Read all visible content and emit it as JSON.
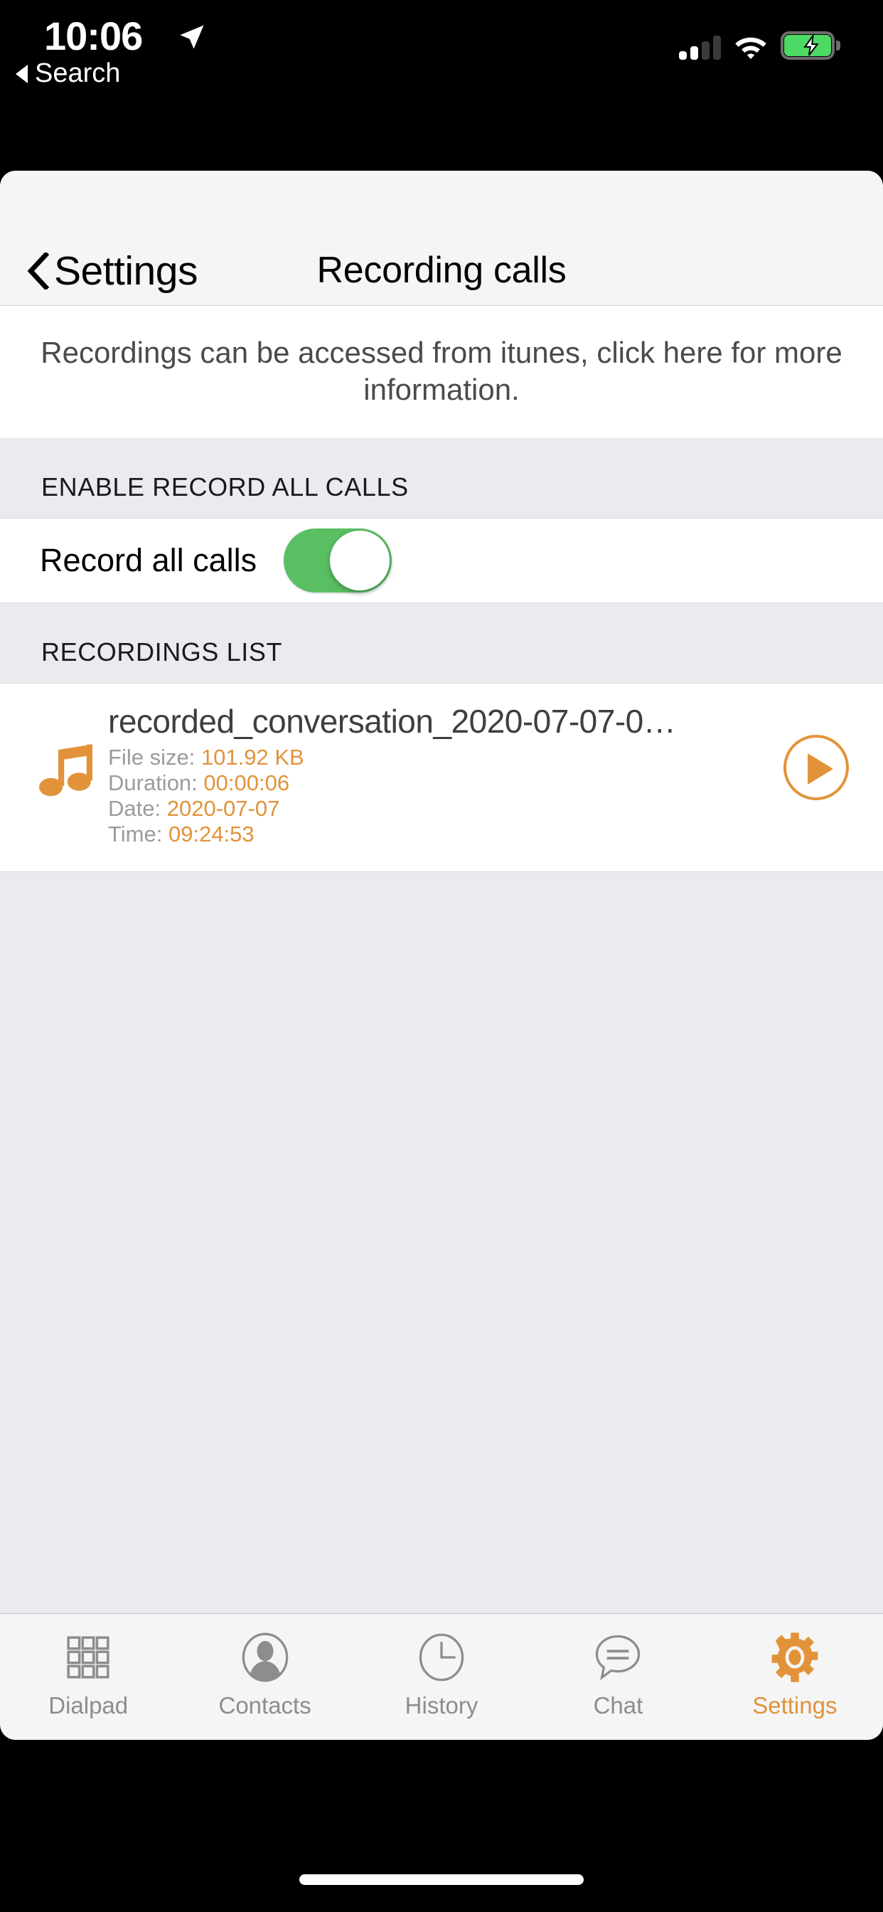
{
  "status_bar": {
    "time": "10:06",
    "location_icon": "location-arrow-icon",
    "back_label": "Search",
    "signal_icon": "cellular-signal-icon",
    "signal_bars_filled": 2,
    "signal_bars_total": 4,
    "wifi_icon": "wifi-icon",
    "battery_icon": "battery-charging-icon",
    "battery_color": "#4CD964"
  },
  "nav": {
    "back_label": "Settings",
    "back_icon": "chevron-left-icon",
    "title": "Recording calls"
  },
  "description": "Recordings can be accessed from itunes, click here for more information.",
  "sections": {
    "enable": {
      "header": "ENABLE RECORD ALL CALLS",
      "row_label": "Record all calls",
      "toggle_on": true,
      "toggle_color": "#5ABF63"
    },
    "recordings": {
      "header": "RECORDINGS LIST",
      "items": [
        {
          "icon": "music-note-icon",
          "name": "recorded_conversation_2020-07-07-0…",
          "file_size_label": "File size:",
          "file_size_value": "101.92 KB",
          "duration_label": "Duration:",
          "duration_value": "00:00:06",
          "date_label": "Date:",
          "date_value": "2020-07-07",
          "time_label": "Time:",
          "time_value": "09:24:53",
          "play_icon": "play-icon"
        }
      ]
    }
  },
  "tabbar": {
    "items": [
      {
        "label": "Dialpad",
        "icon": "dialpad-icon",
        "active": false
      },
      {
        "label": "Contacts",
        "icon": "contacts-icon",
        "active": false
      },
      {
        "label": "History",
        "icon": "clock-icon",
        "active": false
      },
      {
        "label": "Chat",
        "icon": "chat-bubble-icon",
        "active": false
      },
      {
        "label": "Settings",
        "icon": "gear-icon",
        "active": true
      }
    ],
    "active_color": "#E2933A",
    "inactive_color": "#8d8d8d"
  },
  "theme": {
    "accent_orange": "#E2933A",
    "group_bg": "#EBEAEF",
    "cell_bg": "#FFFFFF",
    "nav_bg": "#F5F5F6"
  },
  "home_indicator": "home-indicator"
}
